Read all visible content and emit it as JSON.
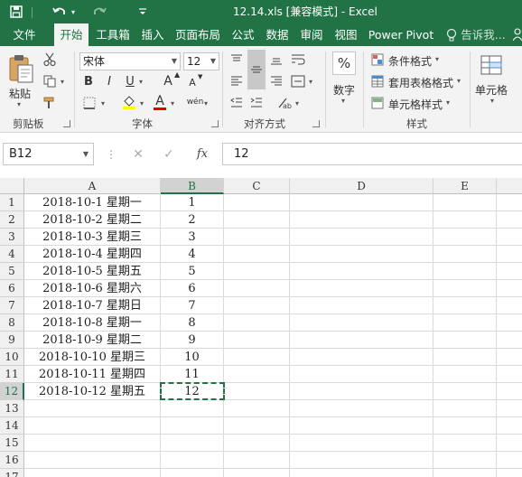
{
  "window": {
    "title": "12.14.xls  [兼容模式] - Excel"
  },
  "ribbon_tabs": [
    "文件",
    "开始",
    "工具箱",
    "插入",
    "页面布局",
    "公式",
    "数据",
    "审阅",
    "视图",
    "Power Pivot",
    "告诉我..."
  ],
  "active_tab": "开始",
  "clipboard": {
    "paste_label": "粘贴",
    "group_label": "剪贴板"
  },
  "font": {
    "name": "宋体",
    "size": "12",
    "bold": "B",
    "italic": "I",
    "underline": "U",
    "grow": "A",
    "shrink": "A",
    "font_color": "A",
    "phonetic": "wén",
    "group_label": "字体"
  },
  "alignment": {
    "group_label": "对齐方式"
  },
  "number": {
    "format_symbol": "%",
    "label": "数字"
  },
  "styles": {
    "conditional_format": "条件格式",
    "table_format": "套用表格格式",
    "cell_styles": "单元格样式",
    "group_label": "样式"
  },
  "cells_group": {
    "label": "单元格"
  },
  "formula_bar": {
    "name_box": "B12",
    "cancel": "✕",
    "enter": "✓",
    "fx": "fx",
    "value": "12"
  },
  "columns": [
    "A",
    "B",
    "C",
    "D",
    "E"
  ],
  "selected_column": "B",
  "selected_row": 12,
  "rows": [
    {
      "num": "1",
      "a": "2018-10-1 星期一",
      "b": "1"
    },
    {
      "num": "2",
      "a": "2018-10-2 星期二",
      "b": "2"
    },
    {
      "num": "3",
      "a": "2018-10-3 星期三",
      "b": "3"
    },
    {
      "num": "4",
      "a": "2018-10-4 星期四",
      "b": "4"
    },
    {
      "num": "5",
      "a": "2018-10-5 星期五",
      "b": "5"
    },
    {
      "num": "6",
      "a": "2018-10-6 星期六",
      "b": "6"
    },
    {
      "num": "7",
      "a": "2018-10-7 星期日",
      "b": "7"
    },
    {
      "num": "8",
      "a": "2018-10-8 星期一",
      "b": "8"
    },
    {
      "num": "9",
      "a": "2018-10-9 星期二",
      "b": "9"
    },
    {
      "num": "10",
      "a": "2018-10-10 星期三",
      "b": "10"
    },
    {
      "num": "11",
      "a": "2018-10-11 星期四",
      "b": "11"
    },
    {
      "num": "12",
      "a": "2018-10-12 星期五",
      "b": "12"
    },
    {
      "num": "13",
      "a": "",
      "b": ""
    },
    {
      "num": "14",
      "a": "",
      "b": ""
    },
    {
      "num": "15",
      "a": "",
      "b": ""
    },
    {
      "num": "16",
      "a": "",
      "b": ""
    },
    {
      "num": "17",
      "a": "",
      "b": ""
    }
  ],
  "accent_color": "#217346"
}
